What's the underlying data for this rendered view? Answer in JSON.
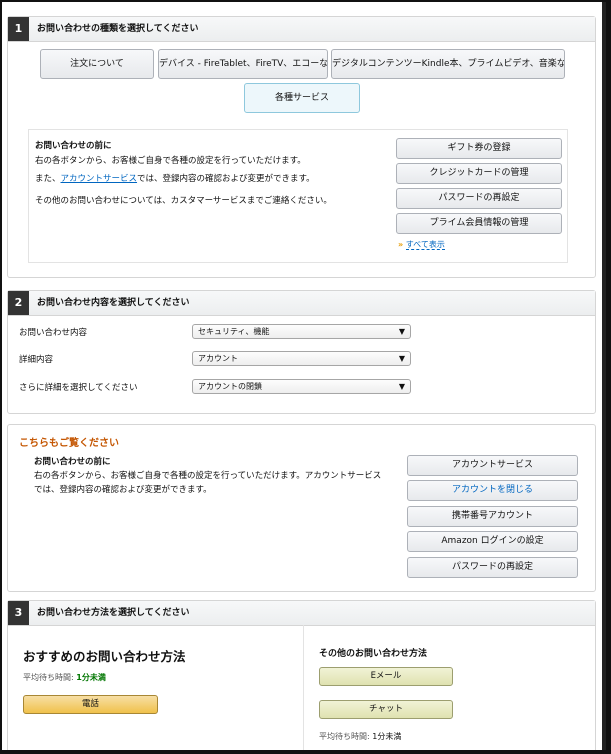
{
  "section1": {
    "step": "1",
    "title": "お問い合わせの種類を選択してください",
    "categories": [
      {
        "label": "注文について"
      },
      {
        "label": "デバイス - FireTablet、FireTV、エコーなど"
      },
      {
        "label": "デジタルコンテンツーKindle本、プライムビデオ、音楽など"
      },
      {
        "label": "各種サービス"
      }
    ],
    "info": {
      "heading": "お問い合わせの前に",
      "line1": "右の各ボタンから、お客様ご自身で各種の設定を行っていただけます。",
      "line2_pre": "また、",
      "line2_link": "アカウントサービス",
      "line2_post": "では、登録内容の確認および変更ができます。",
      "line3": "その他のお問い合わせについては、カスタマーサービスまでご連絡ください。"
    },
    "side_buttons": [
      {
        "label": "ギフト券の登録"
      },
      {
        "label": "クレジットカードの管理"
      },
      {
        "label": "パスワードの再設定"
      },
      {
        "label": "プライム会員情報の管理"
      }
    ],
    "show_all": "すべて表示"
  },
  "section2": {
    "step": "2",
    "title": "お問い合わせ内容を選択してください",
    "rows": [
      {
        "label": "お問い合わせ内容",
        "value": "セキュリティ、機能"
      },
      {
        "label": "詳細内容",
        "value": "アカウント"
      },
      {
        "label": "さらに詳細を選択してください",
        "value": "アカウントの閉鎖"
      }
    ]
  },
  "see_also": {
    "title": "こちらもご覧ください",
    "heading": "お問い合わせの前に",
    "line1": "右の各ボタンから、お客様ご自身で各種の設定を行っていただけます。アカウントサービス",
    "line2": "では、登録内容の確認および変更ができます。",
    "buttons": [
      {
        "label": "アカウントサービス"
      },
      {
        "label": "アカウントを閉じる"
      },
      {
        "label": "携帯番号アカウント"
      },
      {
        "label": "Amazon ログインの設定"
      },
      {
        "label": "パスワードの再設定"
      }
    ]
  },
  "section3": {
    "step": "3",
    "title": "お問い合わせ方法を選択してください",
    "recommended": {
      "title": "おすすめのお問い合わせ方法",
      "wait_label": "平均待ち時間:",
      "wait_value": "1分未満",
      "button": "電話"
    },
    "other": {
      "title": "その他のお問い合わせ方法",
      "email_button": "Eメール",
      "chat_button": "チャット",
      "wait_label": "平均待ち時間:",
      "wait_value": "1分未満"
    }
  },
  "colors": {
    "accent_orange": "#c45500",
    "link_blue": "#0066c0",
    "green": "#007600"
  }
}
